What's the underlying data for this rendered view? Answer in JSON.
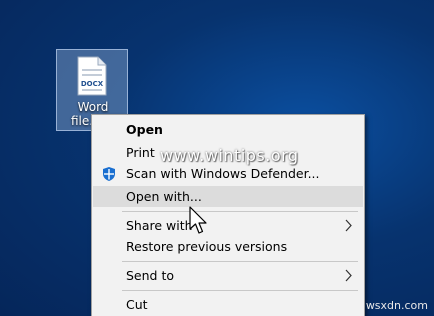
{
  "desktop_icon": {
    "badge": "DOCX",
    "label_line1": "Word",
    "label_line2": "file."
  },
  "context_menu": {
    "items": [
      {
        "label": "Open",
        "bold": true
      },
      {
        "label": "Print"
      },
      {
        "label": "Scan with Windows Defender...",
        "icon": "windows-defender-shield-icon"
      },
      {
        "label": "Open with...",
        "hovered": true
      },
      {
        "label": "Share with",
        "submenu": true
      },
      {
        "label": "Restore previous versions"
      },
      {
        "label": "Send to",
        "submenu": true
      },
      {
        "label": "Cut"
      }
    ]
  },
  "watermark": "www.wintips.org",
  "corner_watermark": "wsxdn.com",
  "colors": {
    "desktop_background": "#07336f",
    "menu_background": "#f2f2f2",
    "hover_background": "#dcdcdc",
    "defender_blue": "#1a6fd0"
  }
}
